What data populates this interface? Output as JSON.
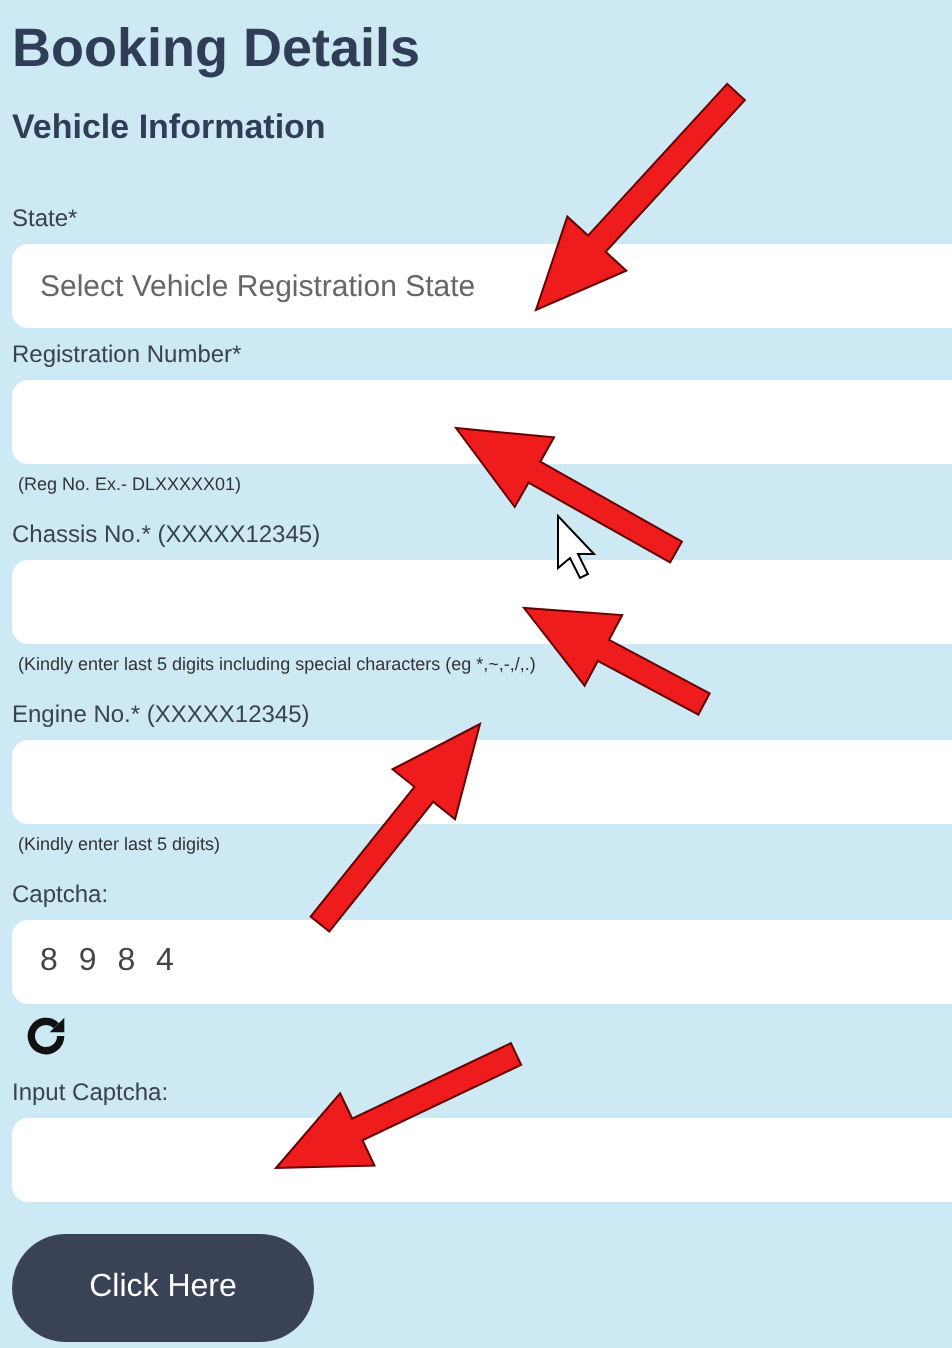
{
  "title": "Booking Details",
  "section": "Vehicle Information",
  "fields": [
    {
      "kind": "select",
      "label": "State*",
      "placeholder": "Select Vehicle Registration State"
    },
    {
      "kind": "text",
      "label": "Registration Number*",
      "hint": "(Reg No. Ex.- DLXXXXX01)"
    },
    {
      "kind": "text",
      "label": "Chassis No.* (XXXXX12345)",
      "hint": "(Kindly enter last 5 digits including special characters (eg *,~,-,/,.)"
    },
    {
      "kind": "text",
      "label": "Engine No.* (XXXXX12345)",
      "hint": "(Kindly enter last 5 digits)"
    },
    {
      "kind": "captcha",
      "label": "Captcha:",
      "value": "8 9 8 4"
    },
    {
      "kind": "text",
      "label": "Input Captcha:"
    }
  ],
  "button": "Click Here"
}
